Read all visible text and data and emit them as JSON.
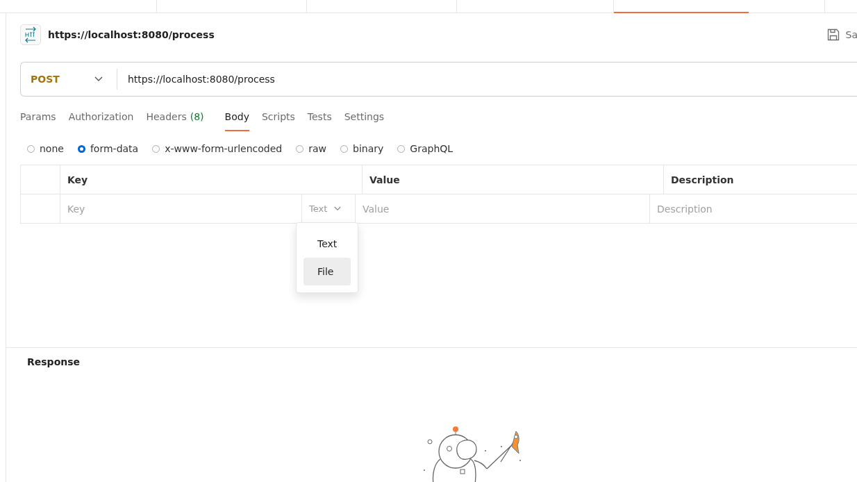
{
  "request": {
    "title": "https://localhost:8080/process",
    "save_label": "Sa",
    "method": "POST",
    "url": "https://localhost:8080/process"
  },
  "tabs": [
    {
      "label": "Params",
      "selected": false
    },
    {
      "label": "Authorization",
      "selected": false
    },
    {
      "label": "Headers",
      "count": "(8)",
      "selected": false
    },
    {
      "label": "Body",
      "selected": true
    },
    {
      "label": "Scripts",
      "selected": false
    },
    {
      "label": "Tests",
      "selected": false
    },
    {
      "label": "Settings",
      "selected": false
    }
  ],
  "body_types": [
    {
      "label": "none",
      "selected": false
    },
    {
      "label": "form-data",
      "selected": true
    },
    {
      "label": "x-www-form-urlencoded",
      "selected": false
    },
    {
      "label": "raw",
      "selected": false
    },
    {
      "label": "binary",
      "selected": false
    },
    {
      "label": "GraphQL",
      "selected": false
    }
  ],
  "table": {
    "columns": [
      "Key",
      "Value",
      "Description"
    ],
    "row": {
      "key_placeholder": "Key",
      "type": "Text",
      "value_placeholder": "Value",
      "description_placeholder": "Description"
    }
  },
  "type_menu": [
    {
      "label": "Text",
      "selected": false
    },
    {
      "label": "File",
      "selected": true
    }
  ],
  "response": {
    "title": "Response"
  }
}
